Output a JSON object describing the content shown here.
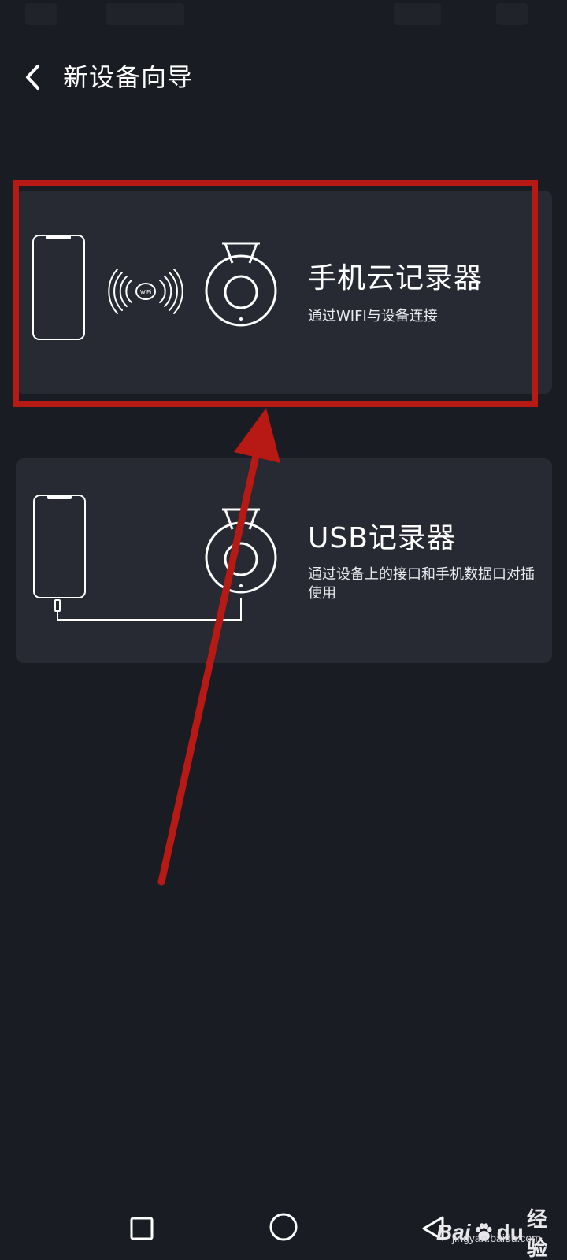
{
  "header": {
    "title": "新设备向导",
    "back_icon": "chevron-left-icon"
  },
  "options": [
    {
      "title": "手机云记录器",
      "description": "通过WIFI与设备连接",
      "connection_label": "WiFi",
      "highlighted": true
    },
    {
      "title": "USB记录器",
      "description": "通过设备上的接口和手机数据口对插使用",
      "highlighted": false
    }
  ],
  "nav_bar": {
    "recent_icon": "square-icon",
    "home_icon": "circle-icon",
    "back_icon": "triangle-back-icon"
  },
  "watermark": {
    "brand_left": "Bai",
    "brand_right": "du",
    "product": "经验",
    "url": "jingyan.baidu.com"
  },
  "colors": {
    "background": "#191c23",
    "card": "#272a33",
    "annotation": "#b71a14",
    "text": "#ffffff"
  }
}
